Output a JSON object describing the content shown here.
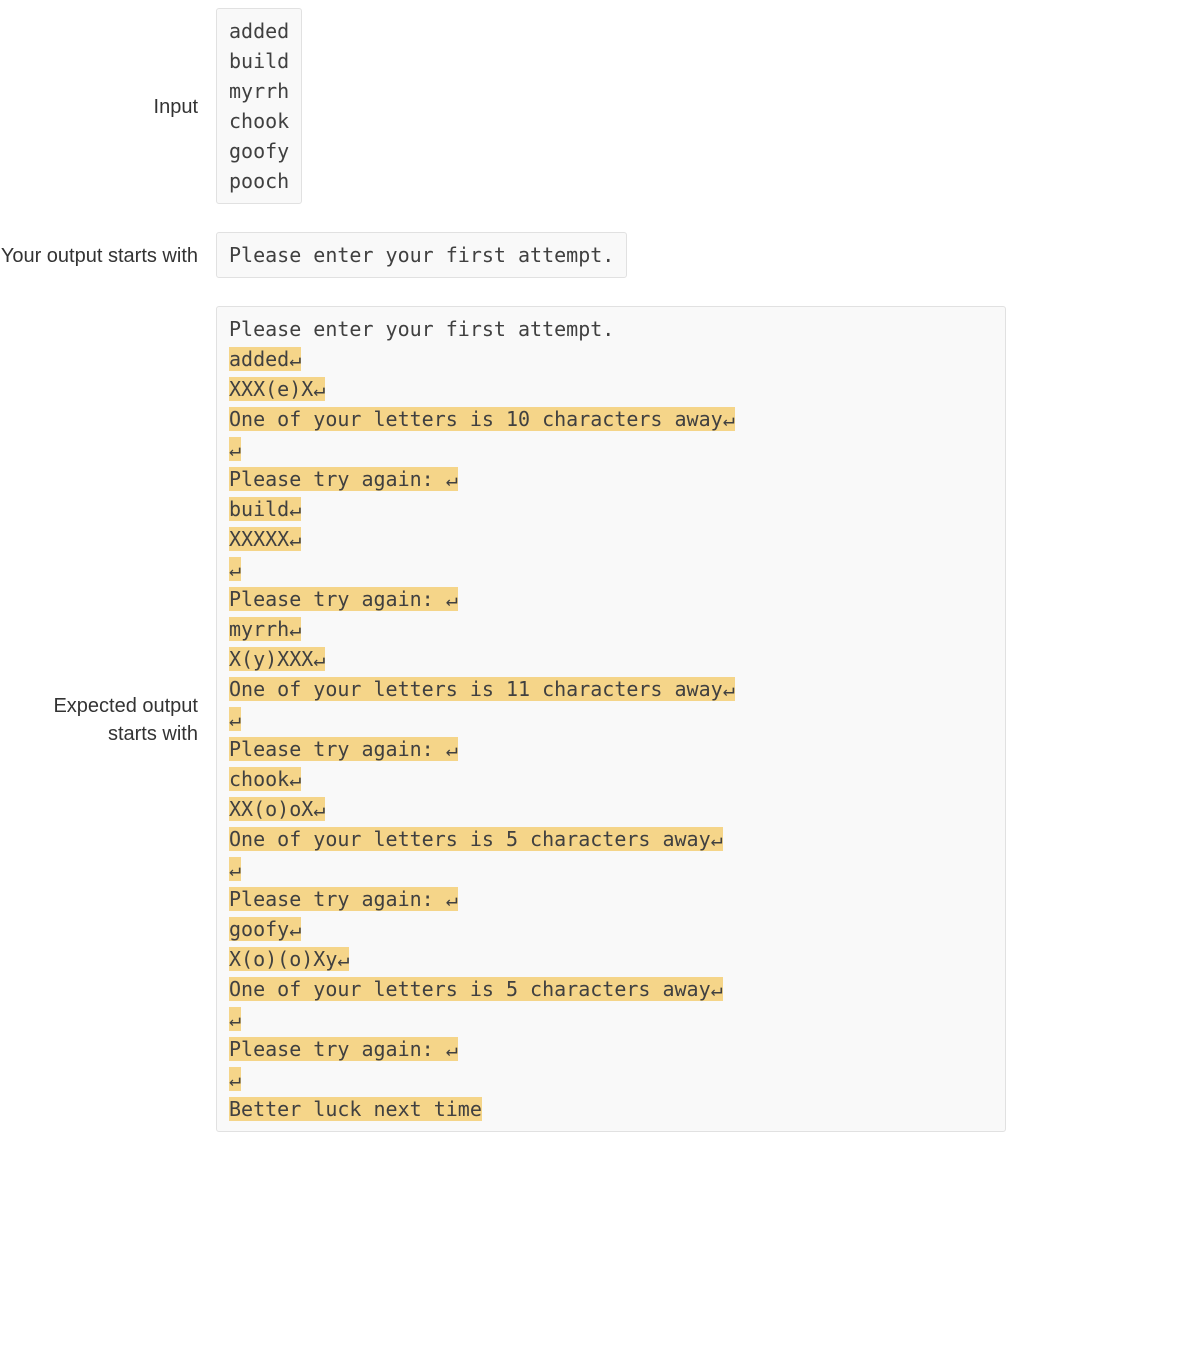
{
  "labels": {
    "input": "Input",
    "your_output": "Your output starts with",
    "expected": "Expected output starts with"
  },
  "input_block": "added\nbuild\nmyrrh\nchook\ngoofy\npooch",
  "your_output_block": "Please enter your first attempt.",
  "return_glyph": "↵",
  "expected_lines": [
    {
      "text": "Please enter your first attempt.",
      "hl": false
    },
    {
      "text": "added",
      "hl": true,
      "crlf": true
    },
    {
      "text": "XXX(e)X",
      "hl": true,
      "crlf": true
    },
    {
      "text": "One of your letters is 10 characters away",
      "hl": true,
      "crlf": true
    },
    {
      "text": "",
      "hl": true,
      "crlf": true
    },
    {
      "text": "Please try again: ",
      "hl": true,
      "crlf": true
    },
    {
      "text": "build",
      "hl": true,
      "crlf": true
    },
    {
      "text": "XXXXX",
      "hl": true,
      "crlf": true
    },
    {
      "text": "",
      "hl": true,
      "crlf": true
    },
    {
      "text": "Please try again: ",
      "hl": true,
      "crlf": true
    },
    {
      "text": "myrrh",
      "hl": true,
      "crlf": true
    },
    {
      "text": "X(y)XXX",
      "hl": true,
      "crlf": true
    },
    {
      "text": "One of your letters is 11 characters away",
      "hl": true,
      "crlf": true
    },
    {
      "text": "",
      "hl": true,
      "crlf": true
    },
    {
      "text": "Please try again: ",
      "hl": true,
      "crlf": true
    },
    {
      "text": "chook",
      "hl": true,
      "crlf": true
    },
    {
      "text": "XX(o)oX",
      "hl": true,
      "crlf": true
    },
    {
      "text": "One of your letters is 5 characters away",
      "hl": true,
      "crlf": true
    },
    {
      "text": "",
      "hl": true,
      "crlf": true
    },
    {
      "text": "Please try again: ",
      "hl": true,
      "crlf": true
    },
    {
      "text": "goofy",
      "hl": true,
      "crlf": true
    },
    {
      "text": "X(o)(o)Xy",
      "hl": true,
      "crlf": true
    },
    {
      "text": "One of your letters is 5 characters away",
      "hl": true,
      "crlf": true
    },
    {
      "text": "",
      "hl": true,
      "crlf": true
    },
    {
      "text": "Please try again: ",
      "hl": true,
      "crlf": true
    },
    {
      "text": "",
      "hl": true,
      "crlf": true
    },
    {
      "text": "Better luck next time",
      "hl": true
    }
  ]
}
